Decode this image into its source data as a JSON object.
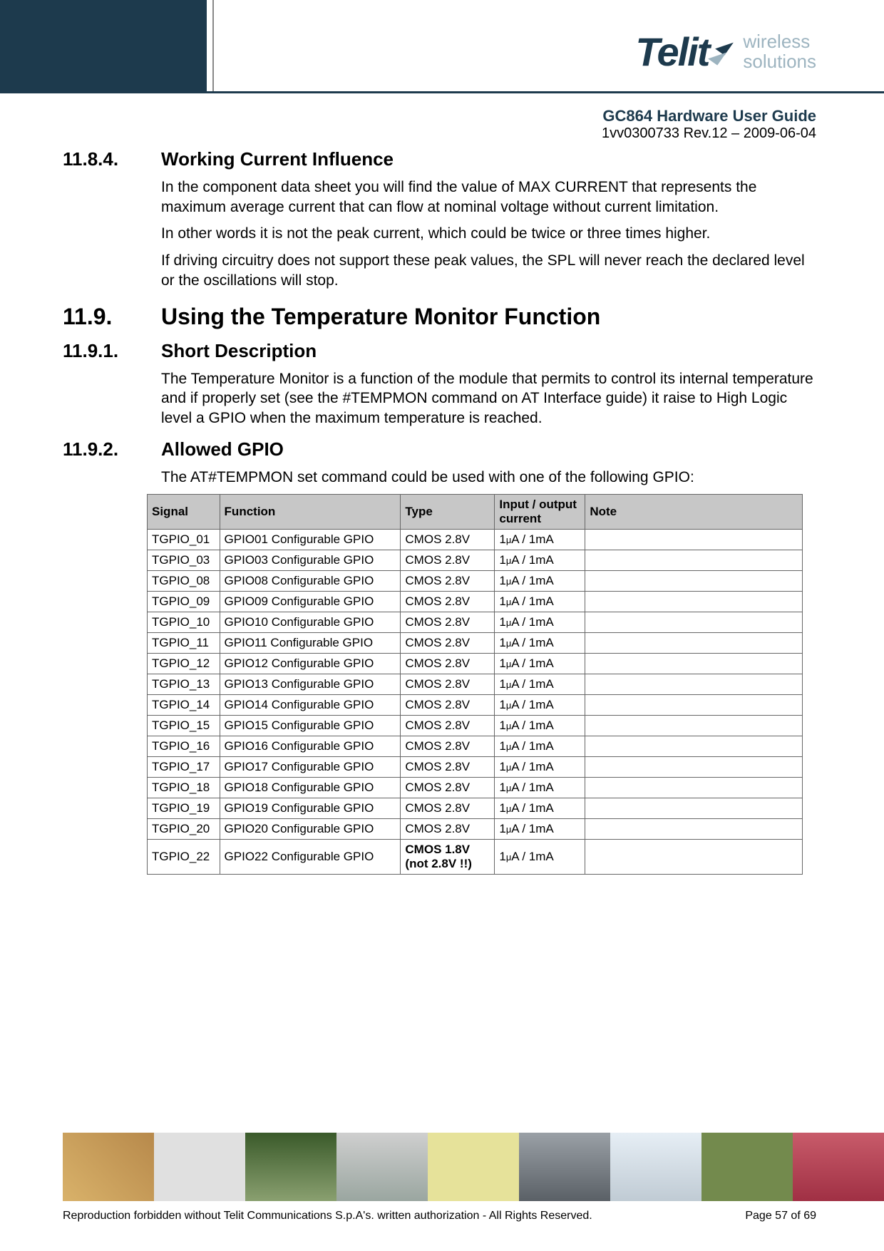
{
  "header": {
    "brand_main": "Telit",
    "brand_sub1": "wireless",
    "brand_sub2": "solutions",
    "doc_title": "GC864 Hardware User Guide",
    "doc_rev": "1vv0300733 Rev.12 – 2009-06-04"
  },
  "sections": {
    "s1_num": "11.8.4.",
    "s1_title": "Working Current Influence",
    "s1_p1": "In the component data sheet you will find the value of MAX CURRENT that represents the maximum average current that can flow at nominal voltage without current limitation.",
    "s1_p2": "In other words it is not the peak current, which could be twice or three times higher.",
    "s1_p3": "If driving circuitry does not support these peak values, the SPL will never reach the declared level or the oscillations will stop.",
    "s2_num": "11.9.",
    "s2_title": "Using the Temperature Monitor Function",
    "s3_num": "11.9.1.",
    "s3_title": "Short Description",
    "s3_p1": "The Temperature Monitor is a function of the module that permits to control its internal temperature and if properly set (see the #TEMPMON command on AT Interface guide) it raise to High Logic level a GPIO when the maximum temperature is reached.",
    "s4_num": "11.9.2.",
    "s4_title": "Allowed GPIO",
    "s4_p1": "The AT#TEMPMON set command could be used with one of the following GPIO:"
  },
  "table": {
    "headers": {
      "signal": "Signal",
      "function": "Function",
      "type": "Type",
      "io": "Input / output current",
      "note": "Note"
    },
    "rows": [
      {
        "signal": "TGPIO_01",
        "function": "GPIO01 Configurable GPIO",
        "type": "CMOS 2.8V",
        "io": "1μA / 1mA",
        "note": ""
      },
      {
        "signal": "TGPIO_03",
        "function": "GPIO03 Configurable GPIO",
        "type": "CMOS 2.8V",
        "io": "1μA / 1mA",
        "note": ""
      },
      {
        "signal": "TGPIO_08",
        "function": "GPIO08 Configurable GPIO",
        "type": "CMOS 2.8V",
        "io": "1μA / 1mA",
        "note": ""
      },
      {
        "signal": "TGPIO_09",
        "function": "GPIO09 Configurable GPIO",
        "type": "CMOS 2.8V",
        "io": "1μA / 1mA",
        "note": ""
      },
      {
        "signal": "TGPIO_10",
        "function": "GPIO10 Configurable GPIO",
        "type": "CMOS 2.8V",
        "io": "1μA / 1mA",
        "note": ""
      },
      {
        "signal": "TGPIO_11",
        "function": "GPIO11 Configurable GPIO",
        "type": "CMOS 2.8V",
        "io": "1μA / 1mA",
        "note": ""
      },
      {
        "signal": "TGPIO_12",
        "function": "GPIO12 Configurable GPIO",
        "type": "CMOS 2.8V",
        "io": "1μA / 1mA",
        "note": ""
      },
      {
        "signal": "TGPIO_13",
        "function": "GPIO13 Configurable GPIO",
        "type": "CMOS 2.8V",
        "io": "1μA / 1mA",
        "note": ""
      },
      {
        "signal": "TGPIO_14",
        "function": "GPIO14 Configurable GPIO",
        "type": "CMOS 2.8V",
        "io": "1μA / 1mA",
        "note": ""
      },
      {
        "signal": "TGPIO_15",
        "function": "GPIO15 Configurable GPIO",
        "type": "CMOS 2.8V",
        "io": "1μA / 1mA",
        "note": ""
      },
      {
        "signal": "TGPIO_16",
        "function": "GPIO16 Configurable GPIO",
        "type": "CMOS 2.8V",
        "io": "1μA / 1mA",
        "note": ""
      },
      {
        "signal": "TGPIO_17",
        "function": "GPIO17 Configurable GPIO",
        "type": "CMOS 2.8V",
        "io": "1μA / 1mA",
        "note": ""
      },
      {
        "signal": "TGPIO_18",
        "function": "GPIO18 Configurable GPIO",
        "type": "CMOS 2.8V",
        "io": "1μA / 1mA",
        "note": ""
      },
      {
        "signal": "TGPIO_19",
        "function": "GPIO19 Configurable GPIO",
        "type": "CMOS 2.8V",
        "io": "1μA / 1mA",
        "note": ""
      },
      {
        "signal": "TGPIO_20",
        "function": "GPIO20 Configurable GPIO",
        "type": "CMOS 2.8V",
        "io": "1μA / 1mA",
        "note": ""
      },
      {
        "signal": "TGPIO_22",
        "function": "GPIO22 Configurable GPIO",
        "type": "CMOS 1.8V (not 2.8V !!)",
        "io": "1μA / 1mA",
        "note": "",
        "bold_type": true
      }
    ]
  },
  "footer": {
    "copyright": "Reproduction forbidden without Telit Communications S.p.A's. written authorization - All Rights Reserved.",
    "page": "Page 57 of 69"
  }
}
